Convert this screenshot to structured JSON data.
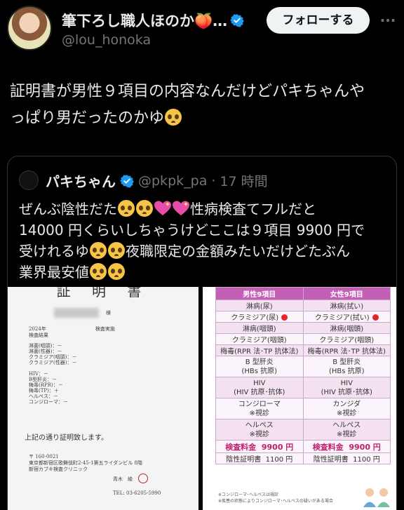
{
  "author": {
    "display_name": "筆下ろし職人ほのか🍑…",
    "handle": "@lou_honoka",
    "follow_label": "フォローする",
    "more_label": "···"
  },
  "tweet": {
    "line1": "証明書が男性９項目の内容なんだけどパキちゃんや",
    "line2": "っぱり男だったのかゆ"
  },
  "quoted": {
    "display_name": "パキちゃん",
    "handle": "@pkpk_pa",
    "time": "17 時間",
    "line1_a": "ぜんぶ陰性だた",
    "line1_b": "性病検査てフルだと",
    "line2": "14000 円くらいしちゃうけどここは９項目 9900 円で",
    "line3_a": "受けれるゆ",
    "line3_b": "夜職限定の金額みたいだけどたぶん",
    "line4_a": "業界最安値"
  },
  "certificate": {
    "title": "証 明 書",
    "name_suffix": "様",
    "line_date": "2024年　　　　　　　　　　検査実施",
    "line_results": "検査結果",
    "results": [
      "淋菌(咽頭)：－",
      "淋菌(性器)：－",
      "クラミジア(咽頭)：－",
      "クラミジア(性器)：－",
      "",
      "HIV：－",
      "B型肝炎：－",
      "梅毒(RPR)：－",
      "梅毒(TP)：＋",
      "ヘルペス：－",
      "コンジローマ：－"
    ],
    "statement": "上記の通り証明致します。",
    "postal": "〒 160-0021",
    "address": "東京都新宿区歌舞伎町2-45-1第五ライダンビル 8階",
    "clinic": "新宿カブキ検査クリニック",
    "doctor": "青木　綾",
    "tel": "TEL: 03-6205-5990"
  },
  "price_table": {
    "header_male": "男性9項目",
    "header_female": "女性9項目",
    "rows": [
      {
        "male": "淋病(尿)",
        "female": "淋病(拭い)",
        "style": "alt"
      },
      {
        "male": "クラミジア(尿)",
        "female": "クラミジア(拭い)",
        "style": "plain",
        "dot": true
      },
      {
        "male": "淋病(咽頭)",
        "female": "淋病(咽頭)",
        "style": "alt"
      },
      {
        "male": "クラミジア(咽頭)",
        "female": "クラミジア(咽頭)",
        "style": "plain"
      },
      {
        "male": "梅毒(RPR 法･TP 抗体法)",
        "female": "梅毒(RPR 法･TP 抗体法)",
        "style": "alt"
      },
      {
        "male": "B 型肝炎",
        "male2": "(HBs 抗原)",
        "female": "B 型肝炎",
        "female2": "(HBs 抗原)",
        "style": "plain",
        "tall": true
      },
      {
        "male": "HIV",
        "male2": "(HIV 抗原･抗体)",
        "female": "HIV",
        "female2": "(HIV 抗原･抗体)",
        "style": "alt",
        "tall": true
      },
      {
        "male": "コンジローマ",
        "male2": "※視診",
        "female": "カンジダ",
        "female2": "※視診",
        "style": "plain",
        "tall": true
      },
      {
        "male": "ヘルペス",
        "male2": "※視診",
        "female": "ヘルペス",
        "female2": "※視診",
        "style": "alt",
        "tall": true
      }
    ],
    "price_label": "検査料金",
    "price_male": "9900 円",
    "price_female": "9900 円",
    "doc_label": "陰性証明書",
    "doc_price": "1100 円",
    "note1": "※コンジローマ･ヘルペスは視診",
    "note2": "※疾患の状態によりコンジローマ･ヘルペスの疑いがある場合"
  },
  "colors": {
    "background": "#000000",
    "verified": "#1d9bf0",
    "table_header": "#c45fb6",
    "price_text": "#c0206e"
  }
}
